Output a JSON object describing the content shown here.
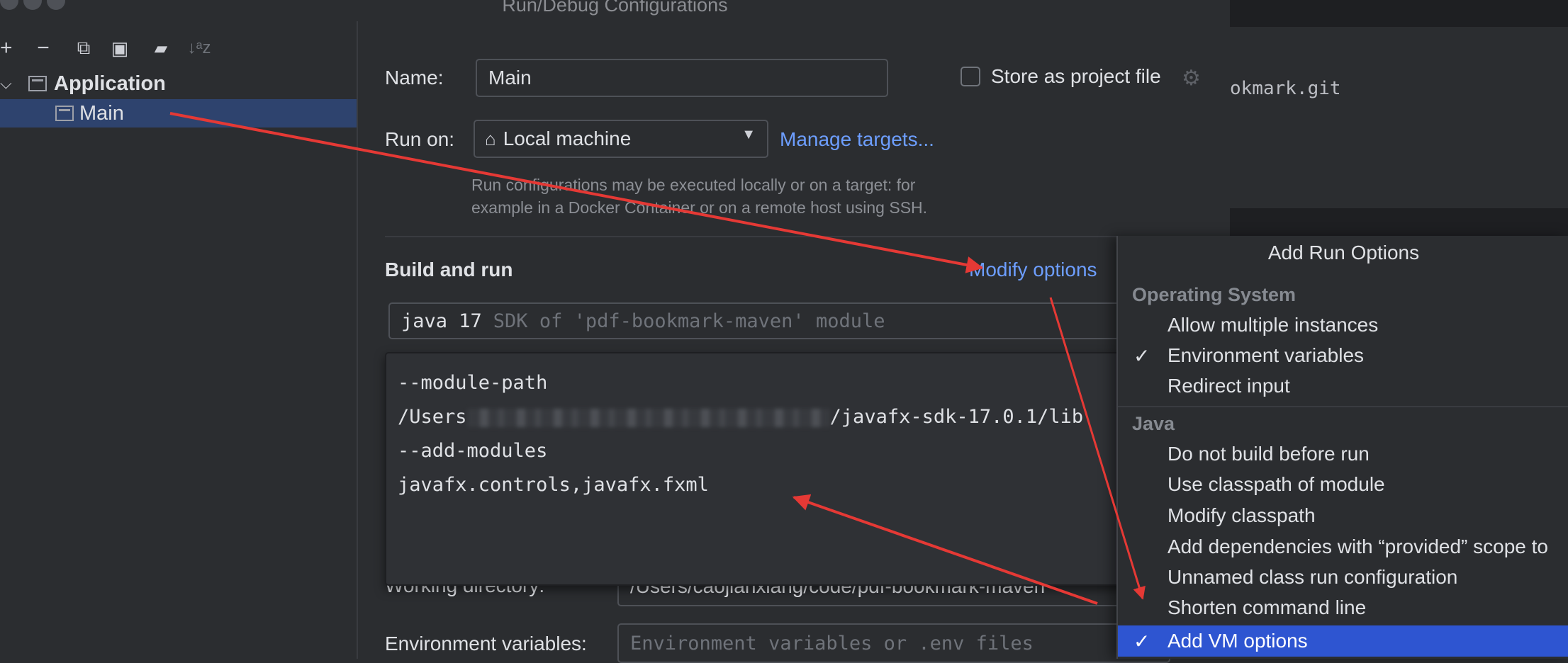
{
  "window": {
    "title": "Run/Debug Configurations"
  },
  "background": {
    "code_fragment": "okmark.git"
  },
  "toolbar": {
    "add_icon": "+",
    "remove_icon": "−",
    "copy_icon": "⧉",
    "save_icon": "▣",
    "folder_icon": "▰",
    "sort_icon": "↓ᵃz"
  },
  "tree": {
    "group": {
      "label": "Application",
      "expanded": true
    },
    "items": [
      {
        "label": "Main",
        "selected": true
      }
    ]
  },
  "form": {
    "name_label": "Name:",
    "name_value": "Main",
    "store_label": "Store as project file",
    "store_checked": false,
    "run_on_label": "Run on:",
    "run_on_value": "Local machine",
    "manage_targets": "Manage targets...",
    "hint_line1": "Run configurations may be executed locally or on a target: for",
    "hint_line2": "example in a Docker Container or on a remote host using SSH.",
    "build_run_label": "Build and run",
    "modify_options": "Modify options",
    "sdk_name": "java 17",
    "sdk_desc": "SDK of 'pdf-bookmark-maven' module",
    "vm_lines": [
      "--module-path",
      "/javafx-sdk-17.0.1/lib",
      "--add-modules",
      "javafx.controls,javafx.fxml"
    ],
    "vm_line2_prefix": "/Users",
    "working_dir_label": "Working directory:",
    "working_dir_value": "/Users/caojianxiang/code/pdf-bookmark-maven",
    "env_label": "Environment variables:",
    "env_placeholder": "Environment variables or .env files"
  },
  "popup": {
    "title": "Add Run Options",
    "sections": [
      {
        "name": "Operating System",
        "items": [
          {
            "label": "Allow multiple instances",
            "checked": false
          },
          {
            "label": "Environment variables",
            "checked": true
          },
          {
            "label": "Redirect input",
            "checked": false
          }
        ]
      },
      {
        "name": "Java",
        "items": [
          {
            "label": "Do not build before run",
            "checked": false
          },
          {
            "label": "Use classpath of module",
            "checked": false
          },
          {
            "label": "Modify classpath",
            "checked": false
          },
          {
            "label": "Add dependencies with “provided” scope to",
            "checked": false
          },
          {
            "label": "Unnamed class run configuration",
            "checked": false
          },
          {
            "label": "Shorten command line",
            "checked": false
          },
          {
            "label": "Add VM options",
            "checked": true,
            "selected": true
          }
        ]
      }
    ],
    "checkmark": "✓"
  },
  "colors": {
    "accent_link": "#6d9eff",
    "selection": "#2e55d1",
    "tree_selection": "#2e436e",
    "annotation_arrow": "#e53935"
  }
}
